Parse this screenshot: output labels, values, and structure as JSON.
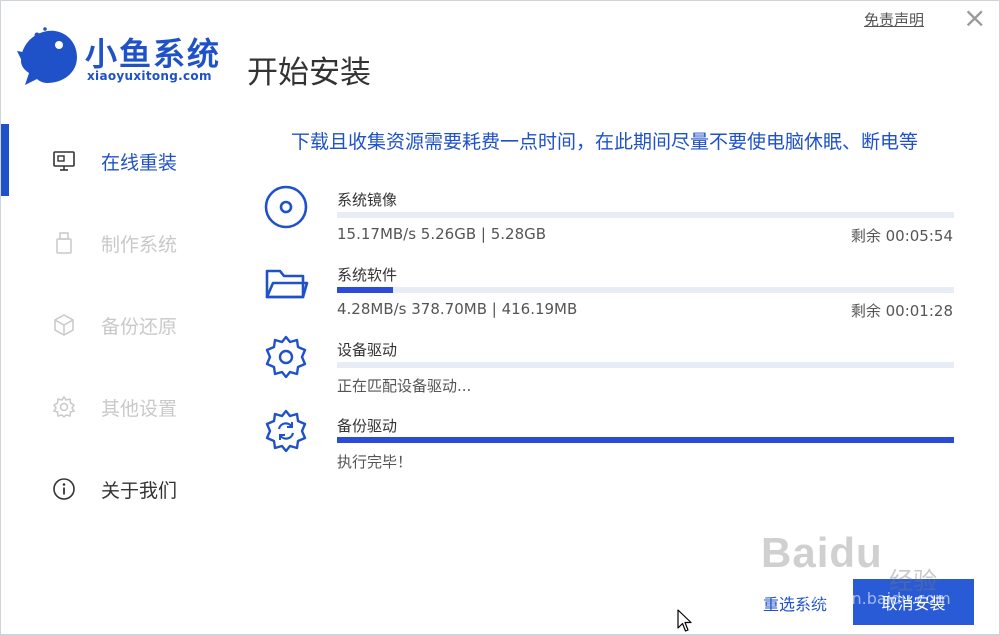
{
  "header": {
    "brand_name": "小鱼系统",
    "brand_url": "xiaoyuxitong.com",
    "page_title": "开始安装",
    "disclaimer": "免责声明",
    "close": "×"
  },
  "sidebar": {
    "items": [
      {
        "label": "在线重装",
        "icon": "monitor-icon",
        "state": "active"
      },
      {
        "label": "制作系统",
        "icon": "usb-icon",
        "state": "disabled"
      },
      {
        "label": "备份还原",
        "icon": "cube-icon",
        "state": "disabled"
      },
      {
        "label": "其他设置",
        "icon": "gear-icon",
        "state": "disabled"
      },
      {
        "label": "关于我们",
        "icon": "info-icon",
        "state": "normal"
      }
    ]
  },
  "main": {
    "notice": "下载且收集资源需要耗费一点时间，在此期间尽量不要使电脑休眠、断电等",
    "tasks": [
      {
        "name": "系统镜像",
        "icon": "disc-icon",
        "progress": 0.0,
        "info": "15.17MB/s 5.26GB | 5.28GB",
        "remaining": "剩余 00:05:54"
      },
      {
        "name": "系统软件",
        "icon": "folder-icon",
        "progress": 0.09,
        "info": "4.28MB/s 378.70MB | 416.19MB",
        "remaining": "剩余 00:01:28"
      },
      {
        "name": "设备驱动",
        "icon": "gear-icon",
        "progress": 0.0,
        "info": "正在匹配设备驱动...",
        "remaining": ""
      },
      {
        "name": "备份驱动",
        "icon": "gear-refresh-icon",
        "progress": 1.0,
        "info": "执行完毕！",
        "remaining": ""
      }
    ]
  },
  "footer": {
    "reselect_label": "重选系统",
    "cancel_label": "取消安装"
  },
  "watermark": {
    "brand": "Baidu",
    "sub": "经验",
    "url": "jingyan.baidu.com"
  },
  "colors": {
    "accent": "#1f52c8",
    "progress": "#2c4bd8",
    "track": "#e8ecf4",
    "button": "#2a5bd7"
  }
}
